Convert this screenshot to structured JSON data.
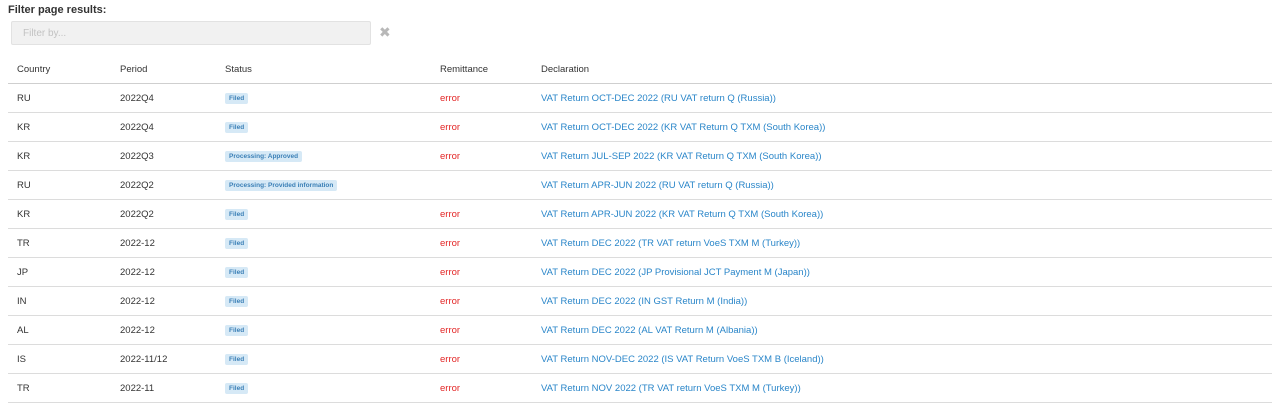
{
  "filter": {
    "label": "Filter page results:",
    "placeholder": "Filter by...",
    "clear_glyph": "✖",
    "clear_icon": "close-icon"
  },
  "table": {
    "headers": {
      "country": "Country",
      "period": "Period",
      "status": "Status",
      "remittance": "Remittance",
      "declaration": "Declaration"
    },
    "rows": [
      {
        "country": "RU",
        "period": "2022Q4",
        "status": "Filed",
        "remittance": "error",
        "declaration": "VAT Return OCT-DEC 2022 (RU VAT return Q (Russia))"
      },
      {
        "country": "KR",
        "period": "2022Q4",
        "status": "Filed",
        "remittance": "error",
        "declaration": "VAT Return OCT-DEC 2022 (KR VAT Return Q TXM (South Korea))"
      },
      {
        "country": "KR",
        "period": "2022Q3",
        "status": "Processing: Approved",
        "remittance": "error",
        "declaration": "VAT Return JUL-SEP 2022 (KR VAT Return Q TXM (South Korea))"
      },
      {
        "country": "RU",
        "period": "2022Q2",
        "status": "Processing: Provided information",
        "remittance": "",
        "declaration": "VAT Return APR-JUN 2022 (RU VAT return Q (Russia))"
      },
      {
        "country": "KR",
        "period": "2022Q2",
        "status": "Filed",
        "remittance": "error",
        "declaration": "VAT Return APR-JUN 2022 (KR VAT Return Q TXM (South Korea))"
      },
      {
        "country": "TR",
        "period": "2022-12",
        "status": "Filed",
        "remittance": "error",
        "declaration": "VAT Return DEC 2022 (TR VAT return VoeS TXM M (Turkey))"
      },
      {
        "country": "JP",
        "period": "2022-12",
        "status": "Filed",
        "remittance": "error",
        "declaration": "VAT Return DEC 2022 (JP Provisional JCT Payment M (Japan))"
      },
      {
        "country": "IN",
        "period": "2022-12",
        "status": "Filed",
        "remittance": "error",
        "declaration": "VAT Return DEC 2022 (IN GST Return M (India))"
      },
      {
        "country": "AL",
        "period": "2022-12",
        "status": "Filed",
        "remittance": "error",
        "declaration": "VAT Return DEC 2022 (AL VAT Return M (Albania))"
      },
      {
        "country": "IS",
        "period": "2022-11/12",
        "status": "Filed",
        "remittance": "error",
        "declaration": "VAT Return NOV-DEC 2022 (IS VAT Return VoeS TXM B (Iceland))"
      },
      {
        "country": "TR",
        "period": "2022-11",
        "status": "Filed",
        "remittance": "error",
        "declaration": "VAT Return NOV 2022 (TR VAT return VoeS TXM M (Turkey))"
      }
    ]
  },
  "colors": {
    "status_badge_bg": "#d6e9f6",
    "status_badge_text": "#3a7fb6",
    "error": "#e32626",
    "link": "#2a86c9"
  }
}
